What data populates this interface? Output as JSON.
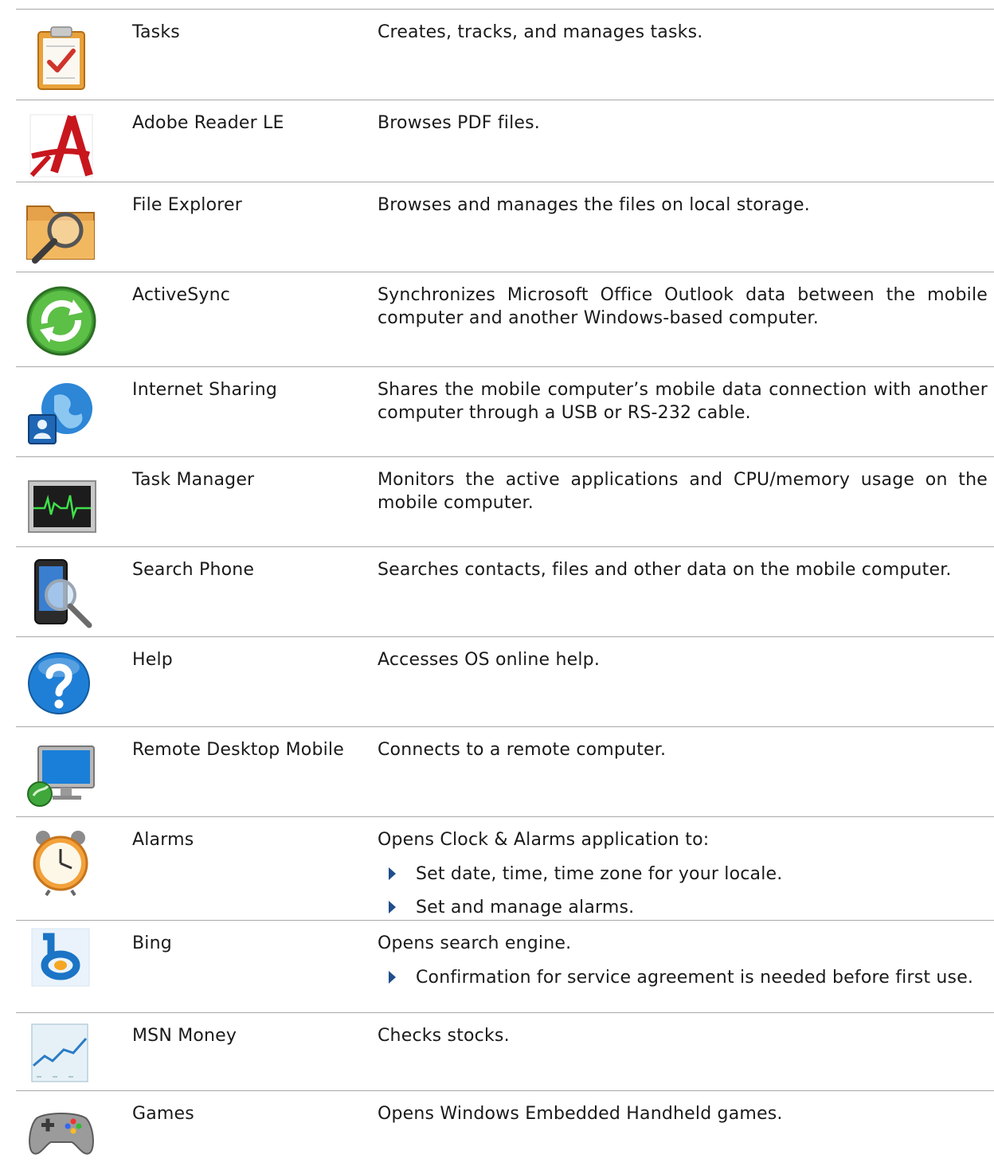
{
  "apps": [
    {
      "icon": "tasks-clipboard-icon",
      "name": "Tasks",
      "description": "Creates, tracks, and manages tasks.",
      "bullets": []
    },
    {
      "icon": "adobe-reader-icon",
      "name": "Adobe Reader LE",
      "description": "Browses PDF files.",
      "bullets": []
    },
    {
      "icon": "folder-magnifier-icon",
      "name": "File Explorer",
      "description": "Browses and manages the files on local storage.",
      "bullets": []
    },
    {
      "icon": "sync-arrows-icon",
      "name": "ActiveSync",
      "description": "Synchronizes Microsoft Office Outlook data between the mobile computer and another Windows-based computer.",
      "bullets": []
    },
    {
      "icon": "globe-user-icon",
      "name": "Internet Sharing",
      "description": "Shares the mobile computer’s mobile data connection with another computer through a USB or RS-232 cable.",
      "bullets": []
    },
    {
      "icon": "heartbeat-monitor-icon",
      "name": "Task Manager",
      "description": "Monitors the active applications and CPU/memory usage on the mobile computer.",
      "bullets": []
    },
    {
      "icon": "phone-search-icon",
      "name": "Search Phone",
      "description": "Searches contacts, files and other data on the mobile computer.",
      "bullets": []
    },
    {
      "icon": "help-question-icon",
      "name": "Help",
      "description": "Accesses OS online help.",
      "bullets": []
    },
    {
      "icon": "remote-monitor-icon",
      "name": "Remote Desktop Mobile",
      "description": "Connects to a remote computer.",
      "bullets": []
    },
    {
      "icon": "alarm-clock-icon",
      "name": "Alarms",
      "description": "Opens Clock & Alarms application to:",
      "bullets": [
        "Set date, time, time zone for your locale.",
        "Set and manage alarms."
      ]
    },
    {
      "icon": "bing-logo-icon",
      "name": "Bing",
      "description": "Opens search engine.",
      "bullets": [
        "Confirmation for service agreement is needed before first use."
      ]
    },
    {
      "icon": "stock-chart-icon",
      "name": "MSN Money",
      "description": "Checks stocks.",
      "bullets": []
    },
    {
      "icon": "gamepad-icon",
      "name": "Games",
      "description": "Opens Windows Embedded Handheld games.",
      "bullets": []
    }
  ]
}
